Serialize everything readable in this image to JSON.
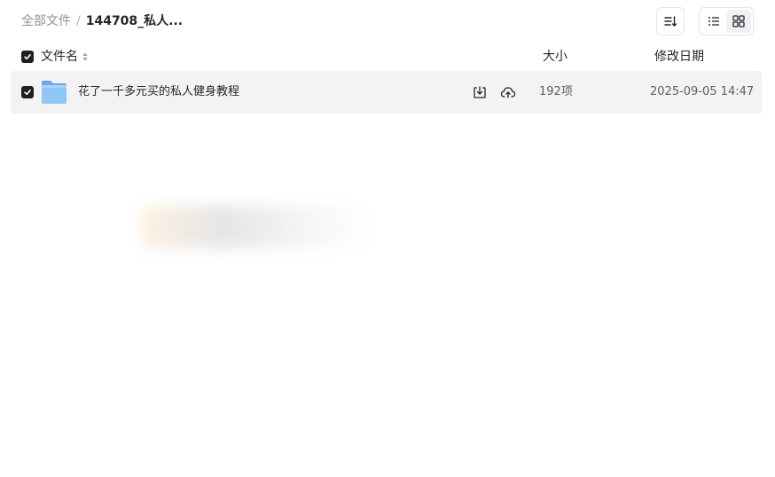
{
  "breadcrumb": {
    "root": "全部文件",
    "separator": "/",
    "current": "144708_私人..."
  },
  "toolbar": {
    "sort_icon": "sort-icon",
    "list_view_icon": "list-view-icon",
    "grid_view_icon": "grid-view-icon"
  },
  "columns": {
    "name": "文件名",
    "size": "大小",
    "date": "修改日期"
  },
  "files": [
    {
      "name": "花了一千多元买的私人健身教程",
      "type": "folder",
      "size": "192项",
      "modified": "2025-09-05 14:47",
      "checked": true
    }
  ],
  "colors": {
    "checkbox": "#1f1f23",
    "row_background": "#f3f3f4",
    "folder": "#7fbbf3",
    "muted_text": "#8f9299"
  }
}
